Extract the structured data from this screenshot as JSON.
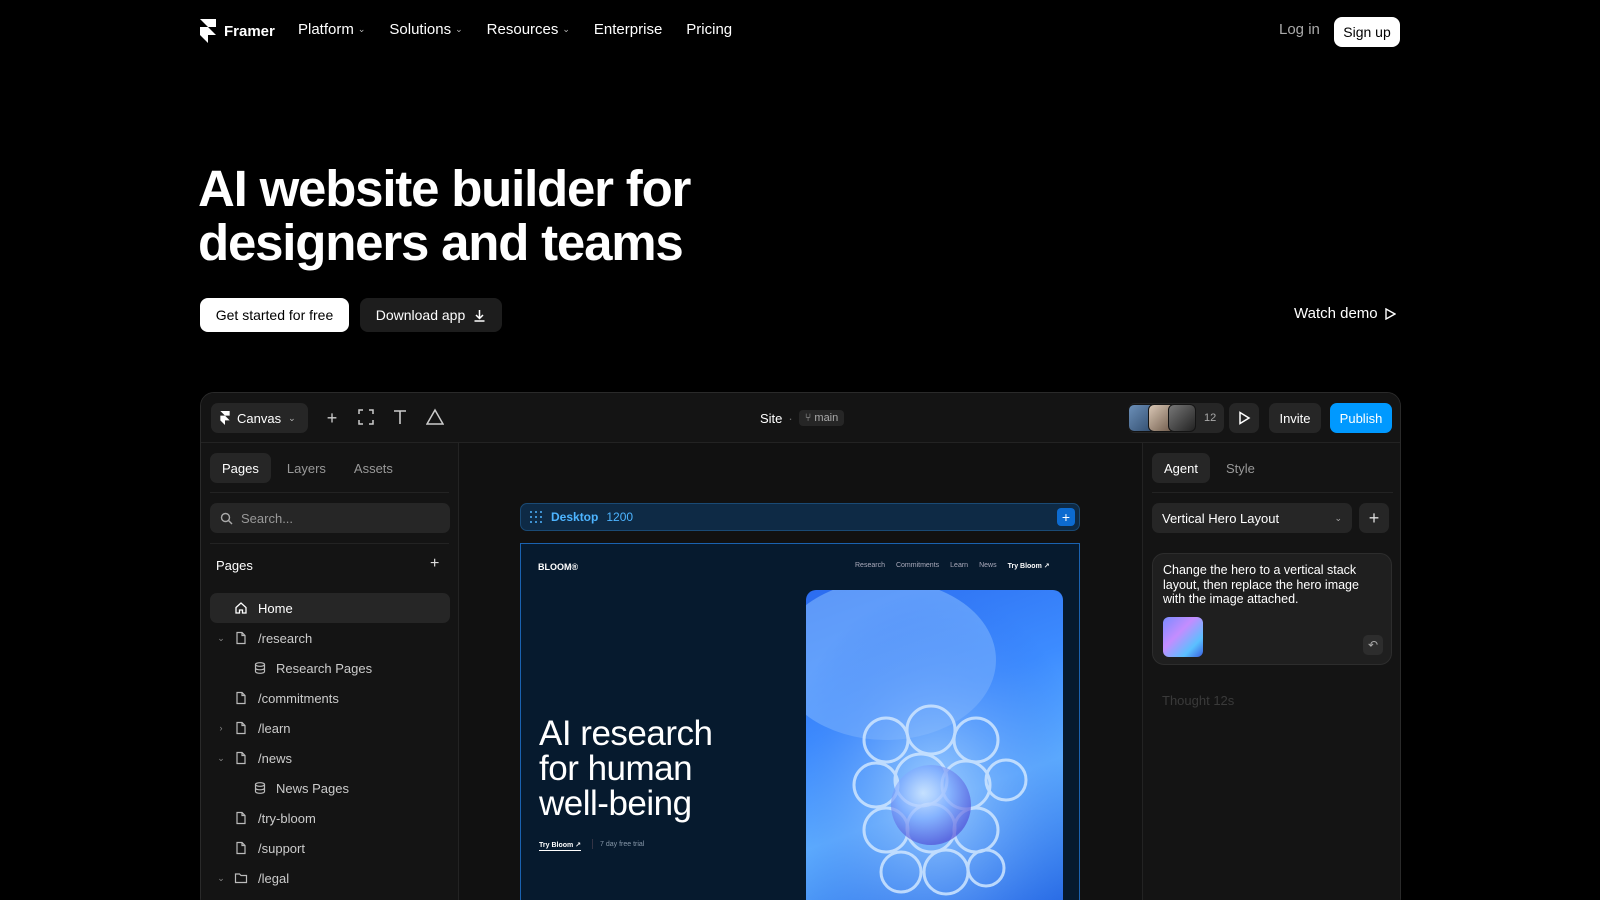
{
  "nav": {
    "brand": "Framer",
    "links": [
      {
        "label": "Platform",
        "dropdown": true
      },
      {
        "label": "Solutions",
        "dropdown": true
      },
      {
        "label": "Resources",
        "dropdown": true
      },
      {
        "label": "Enterprise",
        "dropdown": false
      },
      {
        "label": "Pricing",
        "dropdown": false
      }
    ],
    "login": "Log in",
    "signup": "Sign up"
  },
  "hero": {
    "title_line1": "AI website builder for",
    "title_line2": "designers and teams",
    "primary_cta": "Get started for free",
    "secondary_cta": "Download app",
    "watch_demo": "Watch demo"
  },
  "app": {
    "toolbar": {
      "canvas_label": "Canvas",
      "site_label": "Site",
      "branch": "main",
      "collaborator_count": "12",
      "invite": "Invite",
      "publish": "Publish"
    },
    "left_panel": {
      "tabs": [
        "Pages",
        "Layers",
        "Assets"
      ],
      "active_tab": "Pages",
      "search_placeholder": "Search...",
      "section_title": "Pages",
      "pages": [
        {
          "label": "Home",
          "icon": "home-icon",
          "indent": 0,
          "caret": "",
          "active": true
        },
        {
          "label": "/research",
          "icon": "page-icon",
          "indent": 0,
          "caret": "down"
        },
        {
          "label": "Research Pages",
          "icon": "database-icon",
          "indent": 1,
          "caret": ""
        },
        {
          "label": "/commitments",
          "icon": "page-icon",
          "indent": 0,
          "caret": ""
        },
        {
          "label": "/learn",
          "icon": "page-icon",
          "indent": 0,
          "caret": "right"
        },
        {
          "label": "/news",
          "icon": "page-icon",
          "indent": 0,
          "caret": "down"
        },
        {
          "label": "News Pages",
          "icon": "database-icon",
          "indent": 1,
          "caret": ""
        },
        {
          "label": "/try-bloom",
          "icon": "page-icon",
          "indent": 0,
          "caret": ""
        },
        {
          "label": "/support",
          "icon": "page-icon",
          "indent": 0,
          "caret": ""
        },
        {
          "label": "/legal",
          "icon": "folder-icon",
          "indent": 0,
          "caret": "down"
        }
      ]
    },
    "canvas": {
      "breakpoint_name": "Desktop",
      "breakpoint_width": "1200",
      "preview": {
        "logo": "BLOOM®",
        "nav": [
          "Research",
          "Commitments",
          "Learn",
          "News"
        ],
        "nav_cta": "Try Bloom ↗",
        "headline_1": "AI research",
        "headline_2": "for human",
        "headline_3": "well-being",
        "cta": "Try Bloom ↗",
        "trial": "7 day free trial"
      }
    },
    "right_panel": {
      "tabs": [
        "Agent",
        "Style"
      ],
      "active_tab": "Agent",
      "selected_layout": "Vertical Hero Layout",
      "message": "Change the hero to a vertical stack layout, then replace the hero image with the image attached.",
      "thought": "Thought 12s"
    }
  },
  "colors": {
    "background": "#000000",
    "accent": "#0099ff",
    "panel": "#141414"
  }
}
